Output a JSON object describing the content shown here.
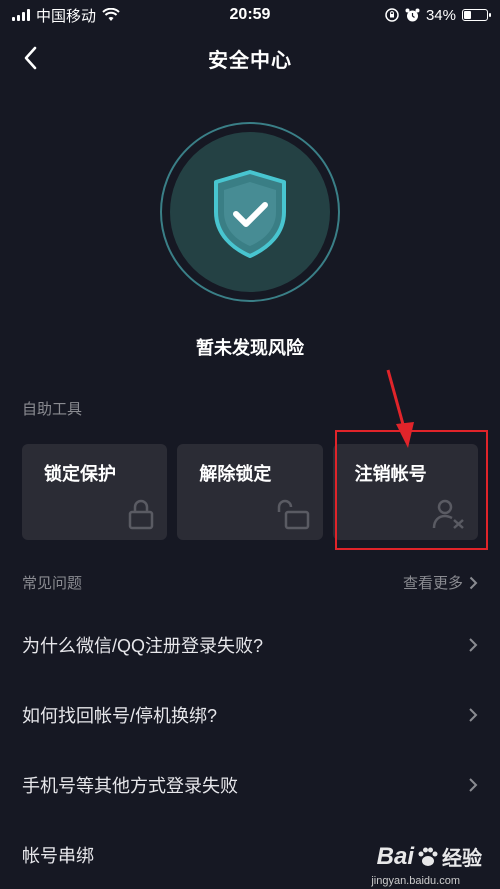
{
  "status_bar": {
    "carrier": "中国移动",
    "time": "20:59",
    "battery": "34%",
    "battery_level": 0.34,
    "icons": [
      "signal-icon",
      "wifi-icon",
      "orientation-lock-icon",
      "alarm-icon",
      "battery-icon"
    ]
  },
  "nav": {
    "title": "安全中心",
    "back_icon": "back-arrow-icon"
  },
  "shield": {
    "icon": "shield-check-icon",
    "status_text": "暂未发现风险",
    "accent_color": "#48c5d0"
  },
  "tools": {
    "section_label": "自助工具",
    "items": [
      {
        "label": "锁定保护",
        "icon": "lock-icon"
      },
      {
        "label": "解除锁定",
        "icon": "unlock-icon"
      },
      {
        "label": "注销帐号",
        "icon": "remove-user-icon"
      }
    ],
    "highlight_color": "#e0242a"
  },
  "faq": {
    "section_label": "常见问题",
    "see_more": "查看更多",
    "items": [
      {
        "label": "为什么微信/QQ注册登录失败?"
      },
      {
        "label": "如何找回帐号/停机换绑?"
      },
      {
        "label": "手机号等其他方式登录失败"
      },
      {
        "label": "帐号串绑"
      }
    ]
  },
  "watermark": {
    "brand": "Bai",
    "brand_cn": "经验",
    "url": "jingyan.baidu.com"
  }
}
